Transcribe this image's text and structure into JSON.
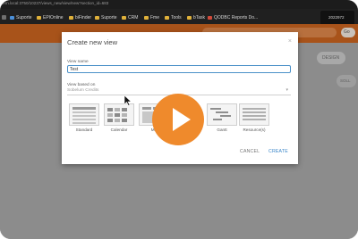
{
  "browser": {
    "url": "fern.local:3750/10237/views_new/view/new?section_id=683",
    "bookmarks": [
      {
        "label": "Suporte",
        "icon": "globe-icon"
      },
      {
        "label": "EPIOnline",
        "icon": "folder-icon"
      },
      {
        "label": "biFinder",
        "icon": "folder-icon"
      },
      {
        "label": "Suporte",
        "icon": "folder-icon"
      },
      {
        "label": "CRM",
        "icon": "folder-icon"
      },
      {
        "label": "Fme",
        "icon": "folder-icon"
      },
      {
        "label": "Tools",
        "icon": "folder-icon"
      },
      {
        "label": "bTask",
        "icon": "folder-icon"
      },
      {
        "label": "QODBC Reports Do...",
        "icon": "qodbc-icon"
      }
    ],
    "popup_number": "2022972"
  },
  "header": {
    "search_button": "Go"
  },
  "page": {
    "design_button": "DESIGN",
    "side_button": "SOLL"
  },
  "dialog": {
    "title": "Create new view",
    "close": "×",
    "view_name_label": "View name",
    "view_name_value": "Test",
    "view_based_label": "View based on",
    "view_based_value": "Sobelum Credits",
    "templates": [
      {
        "label": "Standard"
      },
      {
        "label": "Calendar"
      },
      {
        "label": "Ma"
      },
      {
        "label": ""
      },
      {
        "label": ""
      },
      {
        "label": "Gantt"
      },
      {
        "label": "Resource(s)"
      }
    ],
    "cancel_label": "CANCEL",
    "create_label": "CREATE"
  },
  "colors": {
    "accent": "#3a86c8",
    "header": "#a8531a",
    "play": "#ef8a2c"
  }
}
